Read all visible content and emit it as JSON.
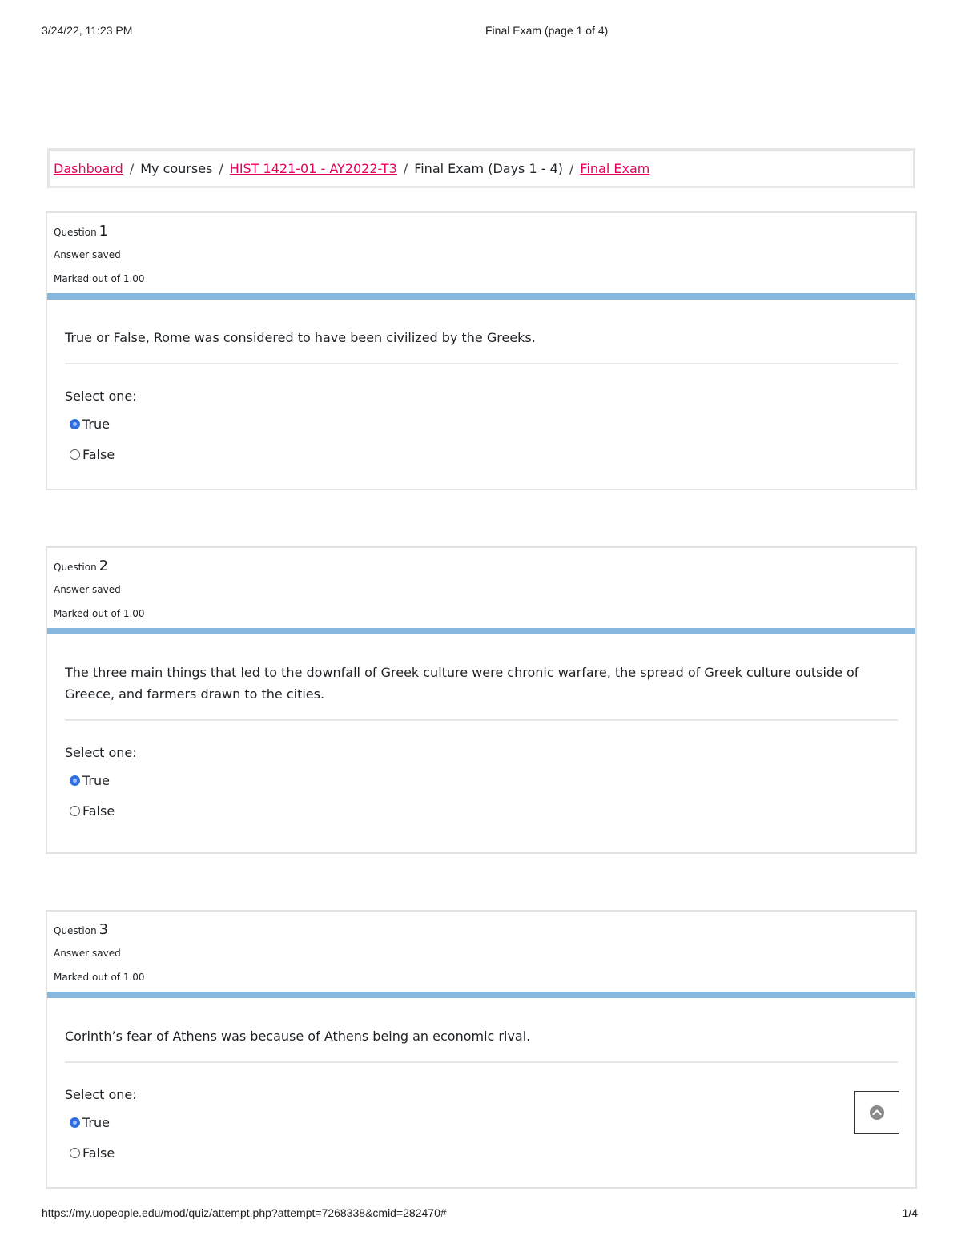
{
  "print_header": {
    "datetime": "3/24/22, 11:23 PM",
    "title": "Final Exam (page 1 of 4)"
  },
  "breadcrumb": {
    "items": [
      {
        "label": "Dashboard",
        "link": true
      },
      {
        "label": "My courses",
        "link": false
      },
      {
        "label": "HIST 1421-01 - AY2022-T3",
        "link": true
      },
      {
        "label": "Final Exam (Days 1 - 4)",
        "link": false
      },
      {
        "label": "Final Exam",
        "link": true
      }
    ],
    "separator": "/"
  },
  "questions": [
    {
      "label": "Question",
      "number": "1",
      "state": "Answer saved",
      "grade": "Marked out of 1.00",
      "text": "True or False, Rome was considered to have been civilized by the Greeks.",
      "prompt": "Select one:",
      "options": [
        {
          "label": "True",
          "selected": true
        },
        {
          "label": "False",
          "selected": false
        }
      ]
    },
    {
      "label": "Question",
      "number": "2",
      "state": "Answer saved",
      "grade": "Marked out of 1.00",
      "text": "The three main things that led to the downfall of Greek culture were chronic warfare, the spread of Greek culture outside of Greece, and farmers drawn to the cities.",
      "prompt": "Select one:",
      "options": [
        {
          "label": "True",
          "selected": true
        },
        {
          "label": "False",
          "selected": false
        }
      ]
    },
    {
      "label": "Question",
      "number": "3",
      "state": "Answer saved",
      "grade": "Marked out of 1.00",
      "text": "Corinth’s fear of Athens was because of Athens being an economic rival.",
      "prompt": "Select one:",
      "options": [
        {
          "label": "True",
          "selected": true
        },
        {
          "label": "False",
          "selected": false
        }
      ]
    }
  ],
  "back_to_top_icon": "chevron-up-circle-icon",
  "print_footer": {
    "url": "https://my.uopeople.edu/mod/quiz/attempt.php?attempt=7268338&cmid=282470#",
    "page": "1/4"
  },
  "colors": {
    "link": "#e6005c",
    "question_bar": "#86b8dd",
    "radio_selected": "#2f6fe0"
  }
}
